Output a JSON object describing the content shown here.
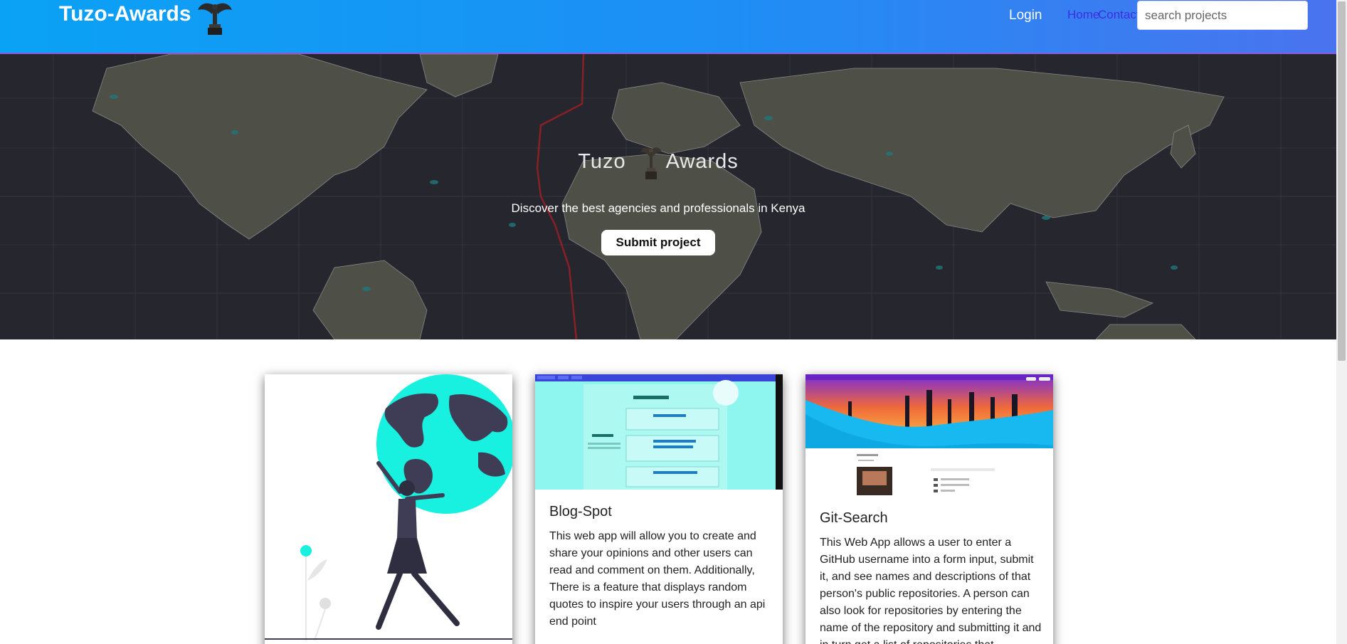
{
  "navbar": {
    "brand": "Tuzo-Awards",
    "login": "Login",
    "home": "Home",
    "contact": "Contact",
    "search_placeholder": "search projects"
  },
  "hero": {
    "title_left": "Tuzo",
    "title_right": "Awards",
    "subtitle": "Discover the best agencies and professionals in Kenya",
    "button": "Submit project"
  },
  "projects": [
    {
      "title": "",
      "description": ""
    },
    {
      "title": "Blog-Spot",
      "description": "This web app will allow you to create and share your opinions and other users can read and comment on them. Additionally, There is a feature that displays random quotes to inspire your users through an api end point"
    },
    {
      "title": "Git-Search",
      "description": "This Web App allows a user to enter a GitHub username into a form input, submit it, and see names and descriptions of that person's public repositories. A person can also look for repositories by entering the name of the repository and submitting it and in turn get a list of repositories that"
    }
  ],
  "colors": {
    "nav_start": "#0aa2f5",
    "nav_end": "#4a73ef",
    "hero_bg": "#2a2b33",
    "accent_teal": "#18f0e0"
  }
}
